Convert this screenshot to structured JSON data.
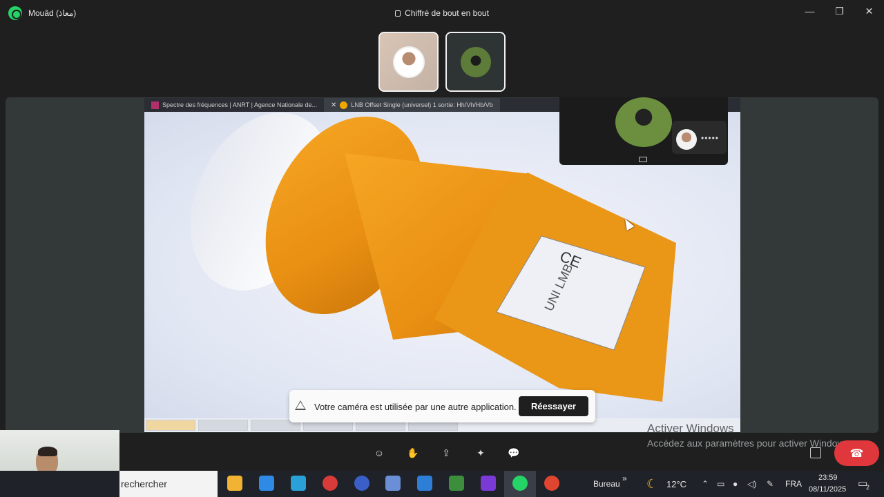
{
  "window": {
    "contact_name": "Mouâd (معاذ)",
    "encryption_label": "Chiffré de bout en bout",
    "controls": {
      "minimize": "—",
      "restore": "❐",
      "close": "✕"
    }
  },
  "shared_screen": {
    "tabs": [
      {
        "label": "Spectre des fréquences | ANRT | Agence Nationale de...",
        "active": false
      },
      {
        "label": "LNB Offset Single (universel) 1 sortie: Hh/Vh/Hb/Vb",
        "active": true
      }
    ]
  },
  "pip": {
    "audio_indicator": "•••••"
  },
  "toast": {
    "message": "Votre caméra est utilisée par une autre application.",
    "retry_label": "Réessayer"
  },
  "watermark": {
    "line1": "Activer Windows",
    "line2": "Accédez aux paramètres pour activer Windows."
  },
  "call_controls": {
    "emoji": "☺",
    "raise_hand": "✋",
    "share": "⇪",
    "effects": "✦",
    "chat": "💬",
    "end_call": "☎"
  },
  "taskbar": {
    "search_placeholder": "rechercher",
    "desktop_label": "Bureau",
    "desktop_chevron": "»",
    "weather": "12°C",
    "language": "FRA",
    "time": "23:59",
    "date": "08/11/2025",
    "notifications": "2",
    "icon_colors": [
      "#f2b233",
      "#2f8ae6",
      "#2aa0d8",
      "#d93b3b",
      "#3a5fc9",
      "#6a8fd6",
      "#2d7ed6",
      "#3c8d3c",
      "#7a3ad6",
      "#25d366",
      "#e0452f"
    ]
  }
}
